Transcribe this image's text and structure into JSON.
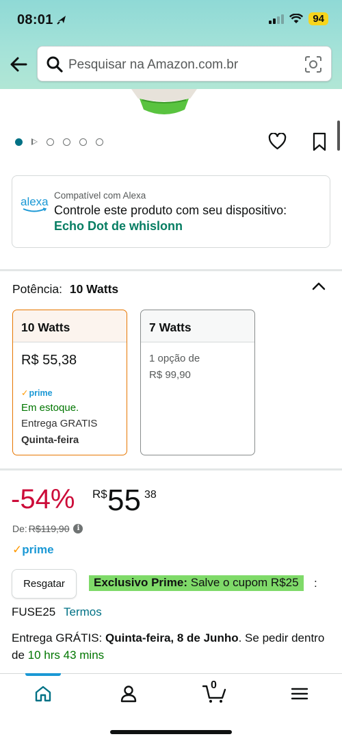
{
  "status_bar": {
    "time": "08:01",
    "battery": "94"
  },
  "search": {
    "placeholder": "Pesquisar na Amazon.com.br"
  },
  "alexa": {
    "logo_text": "alexa",
    "compat_label": "Compatível com Alexa",
    "control_text": "Controle este produto com seu dispositivo:",
    "device_link": "Echo Dot de whislonn"
  },
  "variant": {
    "label": "Potência:",
    "selected": "10 Watts",
    "options": [
      {
        "title": "10 Watts",
        "price": "R$ 55,38",
        "prime": "prime",
        "stock": "Em estoque.",
        "delivery": "Entrega GRATIS",
        "day": "Quinta-feira"
      },
      {
        "title": "7 Watts",
        "line1": "1 opção de",
        "line2": "R$ 99,90"
      }
    ]
  },
  "pricing": {
    "discount": "-54%",
    "currency": "R$",
    "price_int": "55",
    "price_cents": "38",
    "list_label": "De:",
    "list_price": "R$119,90",
    "prime": "prime"
  },
  "coupon": {
    "button": "Resgatar",
    "prefix": "Exclusivo Prime:",
    "text": "Salve o cupom R$25",
    "colon": ":",
    "code": "FUSE25",
    "terms": "Termos"
  },
  "delivery": {
    "prefix": "Entrega GRÁTIS:",
    "date": "Quinta-feira, 8 de Junho",
    "middle": ". Se pedir dentro de",
    "countdown": "10 hrs 43 mins"
  },
  "nav": {
    "cart_count": "0"
  },
  "colors": {
    "accent_teal": "#007185",
    "prime_blue": "#1a98d5",
    "deal_red": "#cc0c39",
    "coupon_green": "#7fda69",
    "selected_orange": "#e77600"
  }
}
